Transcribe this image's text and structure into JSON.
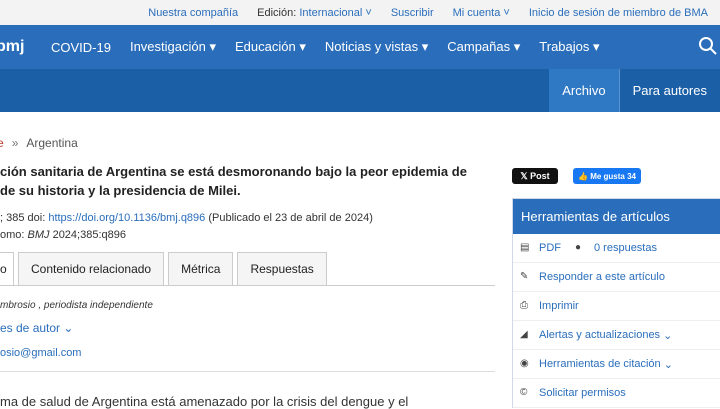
{
  "topbar": {
    "our_company": "Nuestra compañía",
    "edition_label": "Edición:",
    "edition_value": "Internacional",
    "subscribe": "Suscribir",
    "my_account": "Mi cuenta",
    "bma_login": "Inicio de sesión de miembro de BMA"
  },
  "nav": {
    "logo": "bmj",
    "items": [
      "COVID-19",
      "Investigación",
      "Educación",
      "Noticias y vistas",
      "Campañas",
      "Trabajos"
    ]
  },
  "subnav": {
    "archive": "Archivo",
    "for_authors": "Para autores"
  },
  "breadcrumb": {
    "home": "e",
    "sep": "»",
    "current": "Argentina"
  },
  "article": {
    "title_line1": "ción sanitaria de Argentina se está desmoronando bajo la peor epidemia de",
    "title_line2": " de su historia y la presidencia de Milei.",
    "cite_line1_prefix": "; 385  doi: ",
    "doi": "https://doi.org/10.1136/bmj.q896",
    "cite_line1_suffix": " (Publicado el 23 de abril de 2024)",
    "cite_line2_prefix": "omo: ",
    "journal": "BMJ",
    "cite_line2_suffix": " 2024;385:q896",
    "tabs": [
      "o",
      "Contenido relacionado",
      "Métrica",
      "Respuestas"
    ],
    "author": "mbrosio , periodista independiente",
    "author_notes": "es de autor",
    "email": "osio@gmail.com",
    "body_start": "ma de salud de Argentina está amenazado por la crisis del dengue y el"
  },
  "social": {
    "tweet": "Post",
    "like": "Me gusta 34"
  },
  "tools": {
    "title": "Herramientas de artículos",
    "pdf": "PDF",
    "responses": "0 respuestas",
    "respond": "Responder a este artículo",
    "print": "Imprimir",
    "alerts": "Alertas y actualizaciones",
    "citation": "Herramientas de citación",
    "permissions": "Solicitar permisos"
  }
}
